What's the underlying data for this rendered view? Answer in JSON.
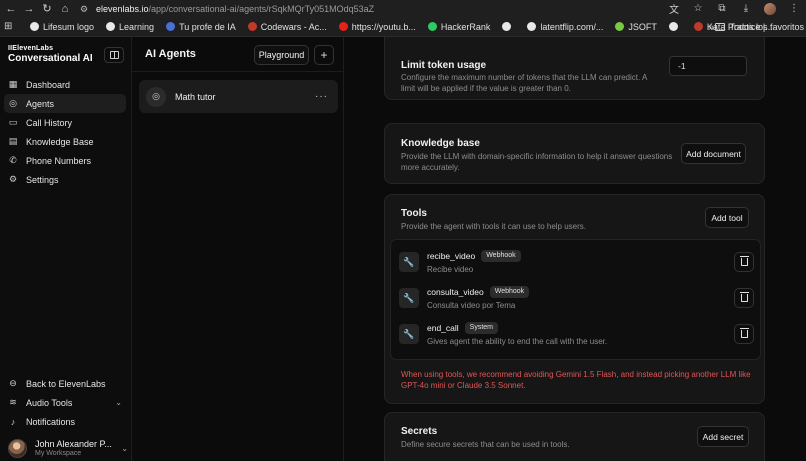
{
  "browser": {
    "url_host": "elevenlabs.io",
    "url_path": "/app/conversational-ai/agents/rSqkMQrTy051MOdq53aZ",
    "bookmarks": [
      {
        "label": "Lifesum logo",
        "color": "#e8e8e8"
      },
      {
        "label": "Learning",
        "color": "#e8e8e8"
      },
      {
        "label": "Tu profe de IA",
        "color": "#4b6fd6"
      },
      {
        "label": "Codewars - Ac...",
        "color": "#c0392b"
      },
      {
        "label": "https://youtu.b...",
        "color": "#e62117"
      },
      {
        "label": "HackerRank",
        "color": "#2ec866"
      },
      {
        "label": "",
        "color": "#e8e8e8"
      },
      {
        "label": "latentflip.com/...",
        "color": "#e8e8e8"
      },
      {
        "label": "JSOFT",
        "color": "#7ac943"
      },
      {
        "label": "",
        "color": "#e8e8e8"
      },
      {
        "label": "Kata Practice |...",
        "color": "#c0392b"
      }
    ],
    "more_label": "»",
    "folder_label": "Todos los favoritos"
  },
  "sidebar": {
    "brand_top": "IIElevenLabs",
    "brand_bottom": "Conversational AI",
    "items": [
      {
        "label": "Dashboard",
        "icon": "grid-icon"
      },
      {
        "label": "Agents",
        "icon": "agent-icon"
      },
      {
        "label": "Call History",
        "icon": "chat-icon"
      },
      {
        "label": "Knowledge Base",
        "icon": "book-icon"
      },
      {
        "label": "Phone Numbers",
        "icon": "phone-icon"
      },
      {
        "label": "Settings",
        "icon": "gear-icon"
      }
    ],
    "bottom_items": [
      {
        "label": "Back to ElevenLabs",
        "icon": "back-icon"
      },
      {
        "label": "Audio Tools",
        "icon": "waveform-icon"
      },
      {
        "label": "Notifications",
        "icon": "bell-icon"
      }
    ],
    "user": {
      "name": "John Alexander P...",
      "workspace": "My Workspace"
    }
  },
  "agents": {
    "title": "AI Agents",
    "playground_label": "Playground",
    "add_label": "+",
    "list": [
      {
        "name": "Math tutor"
      }
    ],
    "more_label": "···"
  },
  "main": {
    "limit_token": {
      "title": "Limit token usage",
      "desc": "Configure the maximum number of tokens that the LLM can predict. A limit will be applied if the value is greater than 0.",
      "value": "-1"
    },
    "knowledge_base": {
      "title": "Knowledge base",
      "desc": "Provide the LLM with domain-specific information to help it answer questions more accurately.",
      "button": "Add document"
    },
    "tools": {
      "title": "Tools",
      "desc": "Provide the agent with tools it can use to help users.",
      "button": "Add tool",
      "items": [
        {
          "name": "recibe_video",
          "badge": "Webhook",
          "desc": "Recibe video"
        },
        {
          "name": "consulta_video",
          "badge": "Webhook",
          "desc": "Consulta video por Tema"
        },
        {
          "name": "end_call",
          "badge": "System",
          "desc": "Gives agent the ability to end the call with the user."
        }
      ],
      "warning": "When using tools, we recommend avoiding Gemini 1.5 Flash, and instead picking another LLM like GPT-4o mini or Claude 3.5 Sonnet."
    },
    "secrets": {
      "title": "Secrets",
      "desc": "Define secure secrets that can be used in tools.",
      "button": "Add secret"
    }
  },
  "colors": {
    "warning": "#e05656",
    "card": "#161616",
    "background": "#0b0b0b"
  }
}
